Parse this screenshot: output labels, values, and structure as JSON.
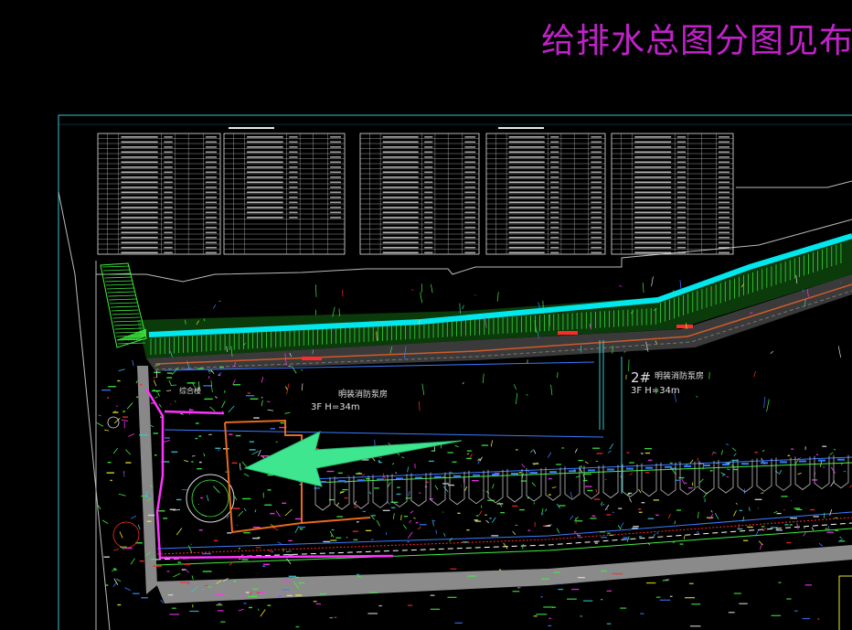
{
  "drawing": {
    "title": "给排水总图分图见布局",
    "labels": {
      "building_2": "2#",
      "building_2_sub": "明装消防泵房",
      "building_2_floors": "3F  H=34m",
      "building_1_floors": "3F  H=34m",
      "building_1_sub": "明装消防泵房",
      "side_label": "综合楼"
    }
  },
  "colors": {
    "background": "#000000",
    "frame": "#33c9cf",
    "title": "#c022c8",
    "water": "#00e8ee",
    "green": "#3ef03e",
    "arrow": "#3ee68f",
    "red": "#ff2a2a",
    "orange": "#e86a1a",
    "magenta": "#ff33ff",
    "table_lines": "#e8e8e8"
  }
}
